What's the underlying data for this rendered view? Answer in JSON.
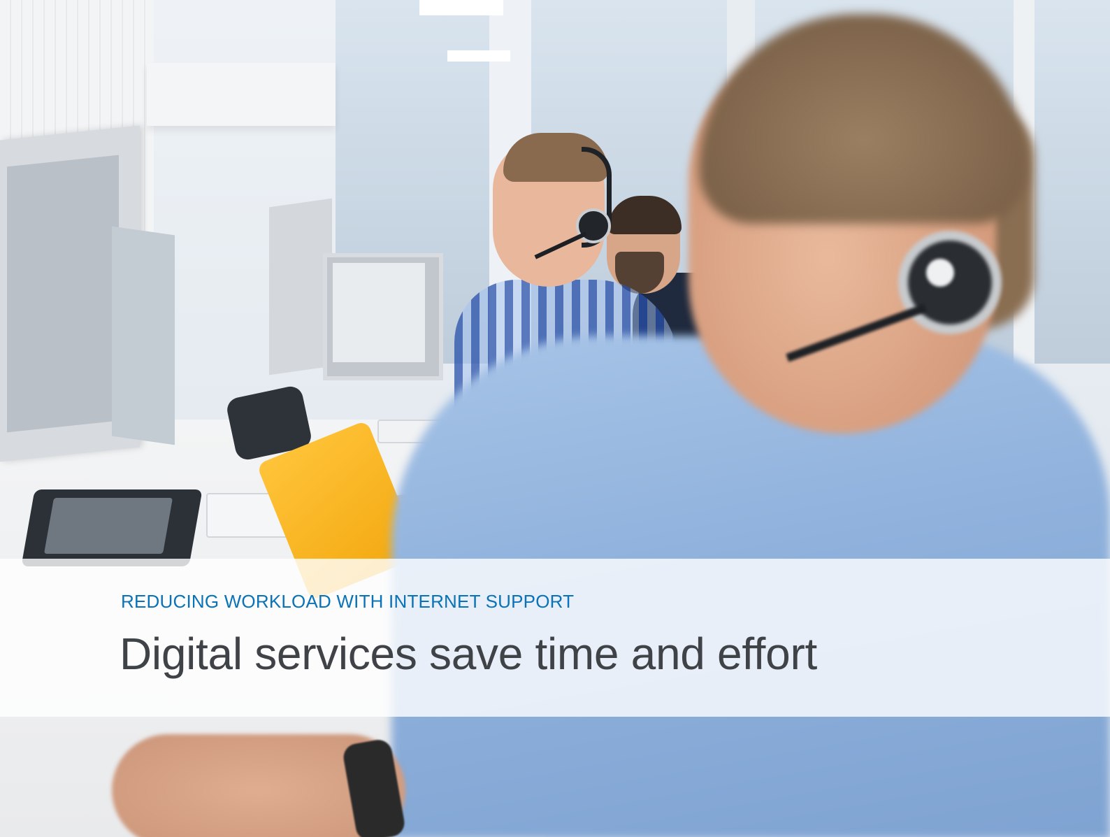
{
  "hero": {
    "image_description_alt": "",
    "eyebrow": "REDUCING WORKLOAD WITH INTERNET SUPPORT",
    "headline": "Digital services save time and effort"
  },
  "colors": {
    "eyebrow": "#0a73b7",
    "headline": "#3f4246",
    "band_background": "rgba(255,255,255,0.80)"
  }
}
